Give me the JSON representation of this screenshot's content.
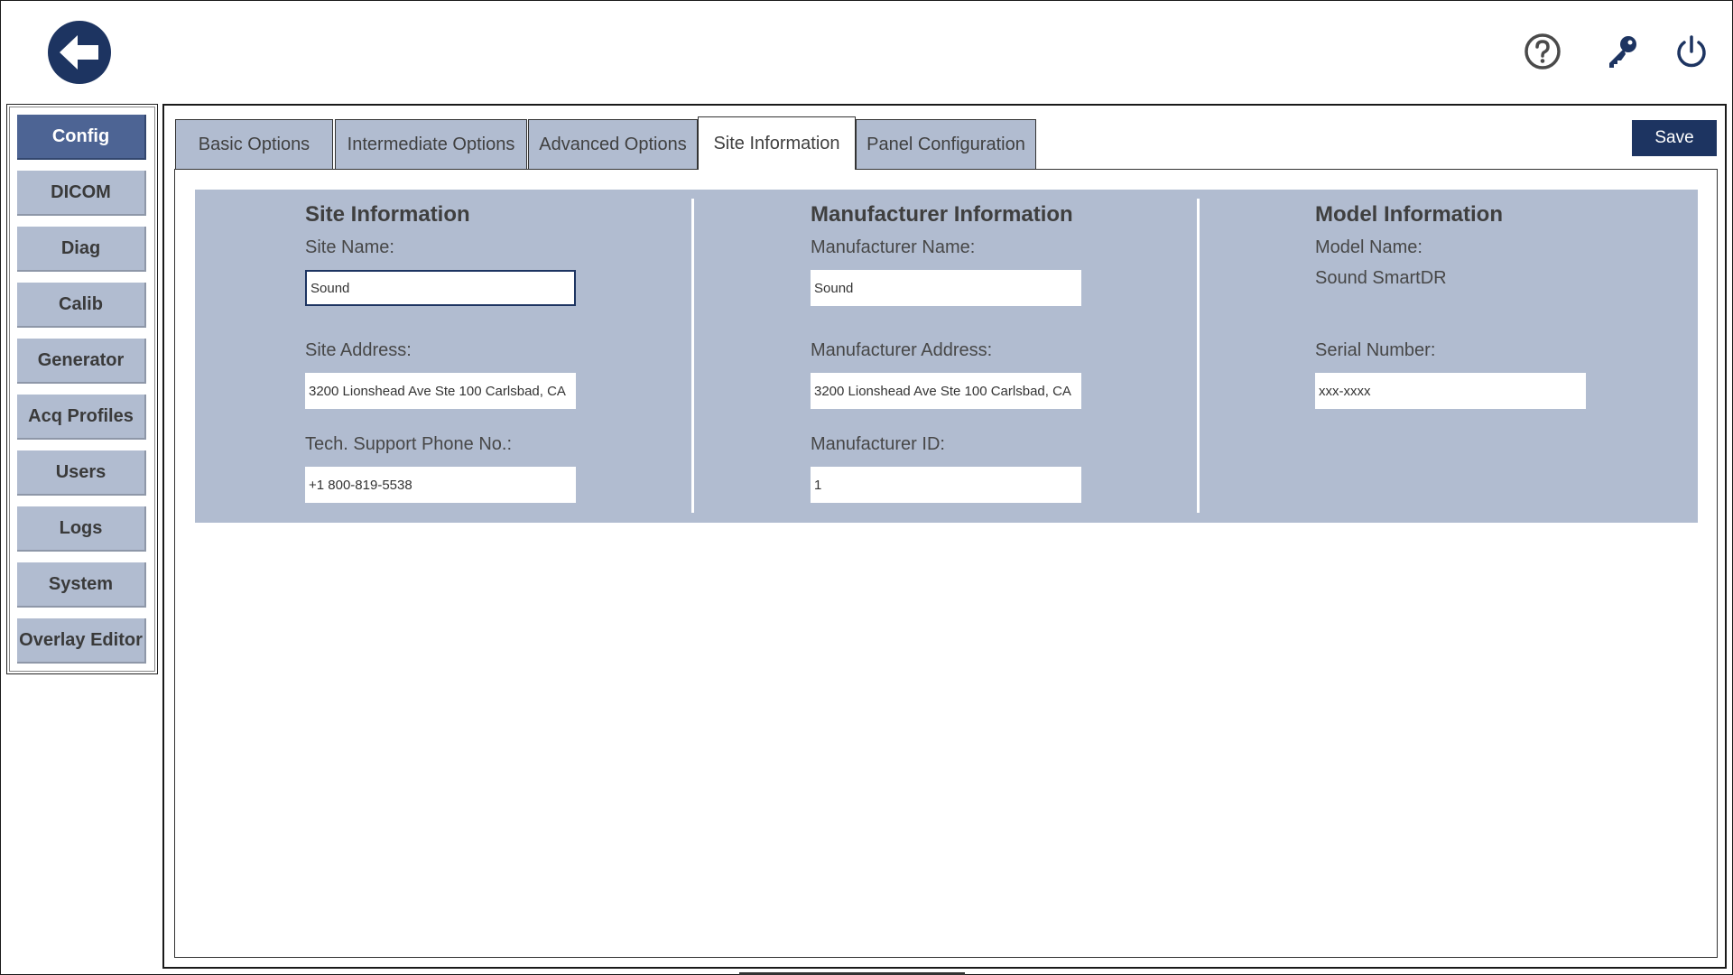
{
  "topbar": {
    "back_icon": "back-arrow-icon",
    "help_icon": "help-icon",
    "key_icon": "key-icon",
    "power_icon": "power-icon",
    "accent_color": "#1d3461"
  },
  "sidebar": {
    "items": [
      {
        "label": "Config",
        "active": true
      },
      {
        "label": "DICOM"
      },
      {
        "label": "Diag"
      },
      {
        "label": "Calib"
      },
      {
        "label": "Generator"
      },
      {
        "label": "Acq Profiles"
      },
      {
        "label": "Users"
      },
      {
        "label": "Logs"
      },
      {
        "label": "System"
      },
      {
        "label": "Overlay Editor"
      }
    ]
  },
  "tabs": [
    {
      "label": "Basic Options"
    },
    {
      "label": "Intermediate Options"
    },
    {
      "label": "Advanced Options"
    },
    {
      "label": "Site Information",
      "active": true
    },
    {
      "label": "Panel Configuration"
    }
  ],
  "toolbar": {
    "save_label": "Save"
  },
  "site": {
    "title": "Site Information",
    "name_label": "Site Name:",
    "name_value": "Sound",
    "address_label": "Site Address:",
    "address_value": "3200 Lionshead Ave Ste 100 Carlsbad, CA",
    "phone_label": "Tech. Support Phone No.:",
    "phone_value": "+1 800-819-5538"
  },
  "manufacturer": {
    "title": "Manufacturer Information",
    "name_label": "Manufacturer Name:",
    "name_value": "Sound",
    "address_label": "Manufacturer Address:",
    "address_value": "3200 Lionshead Ave Ste 100 Carlsbad, CA",
    "id_label": "Manufacturer ID:",
    "id_value": "1"
  },
  "model": {
    "title": "Model Information",
    "name_label": "Model Name:",
    "name_value": "Sound SmartDR",
    "serial_label": "Serial Number:",
    "serial_value": "xxx-xxxx"
  }
}
